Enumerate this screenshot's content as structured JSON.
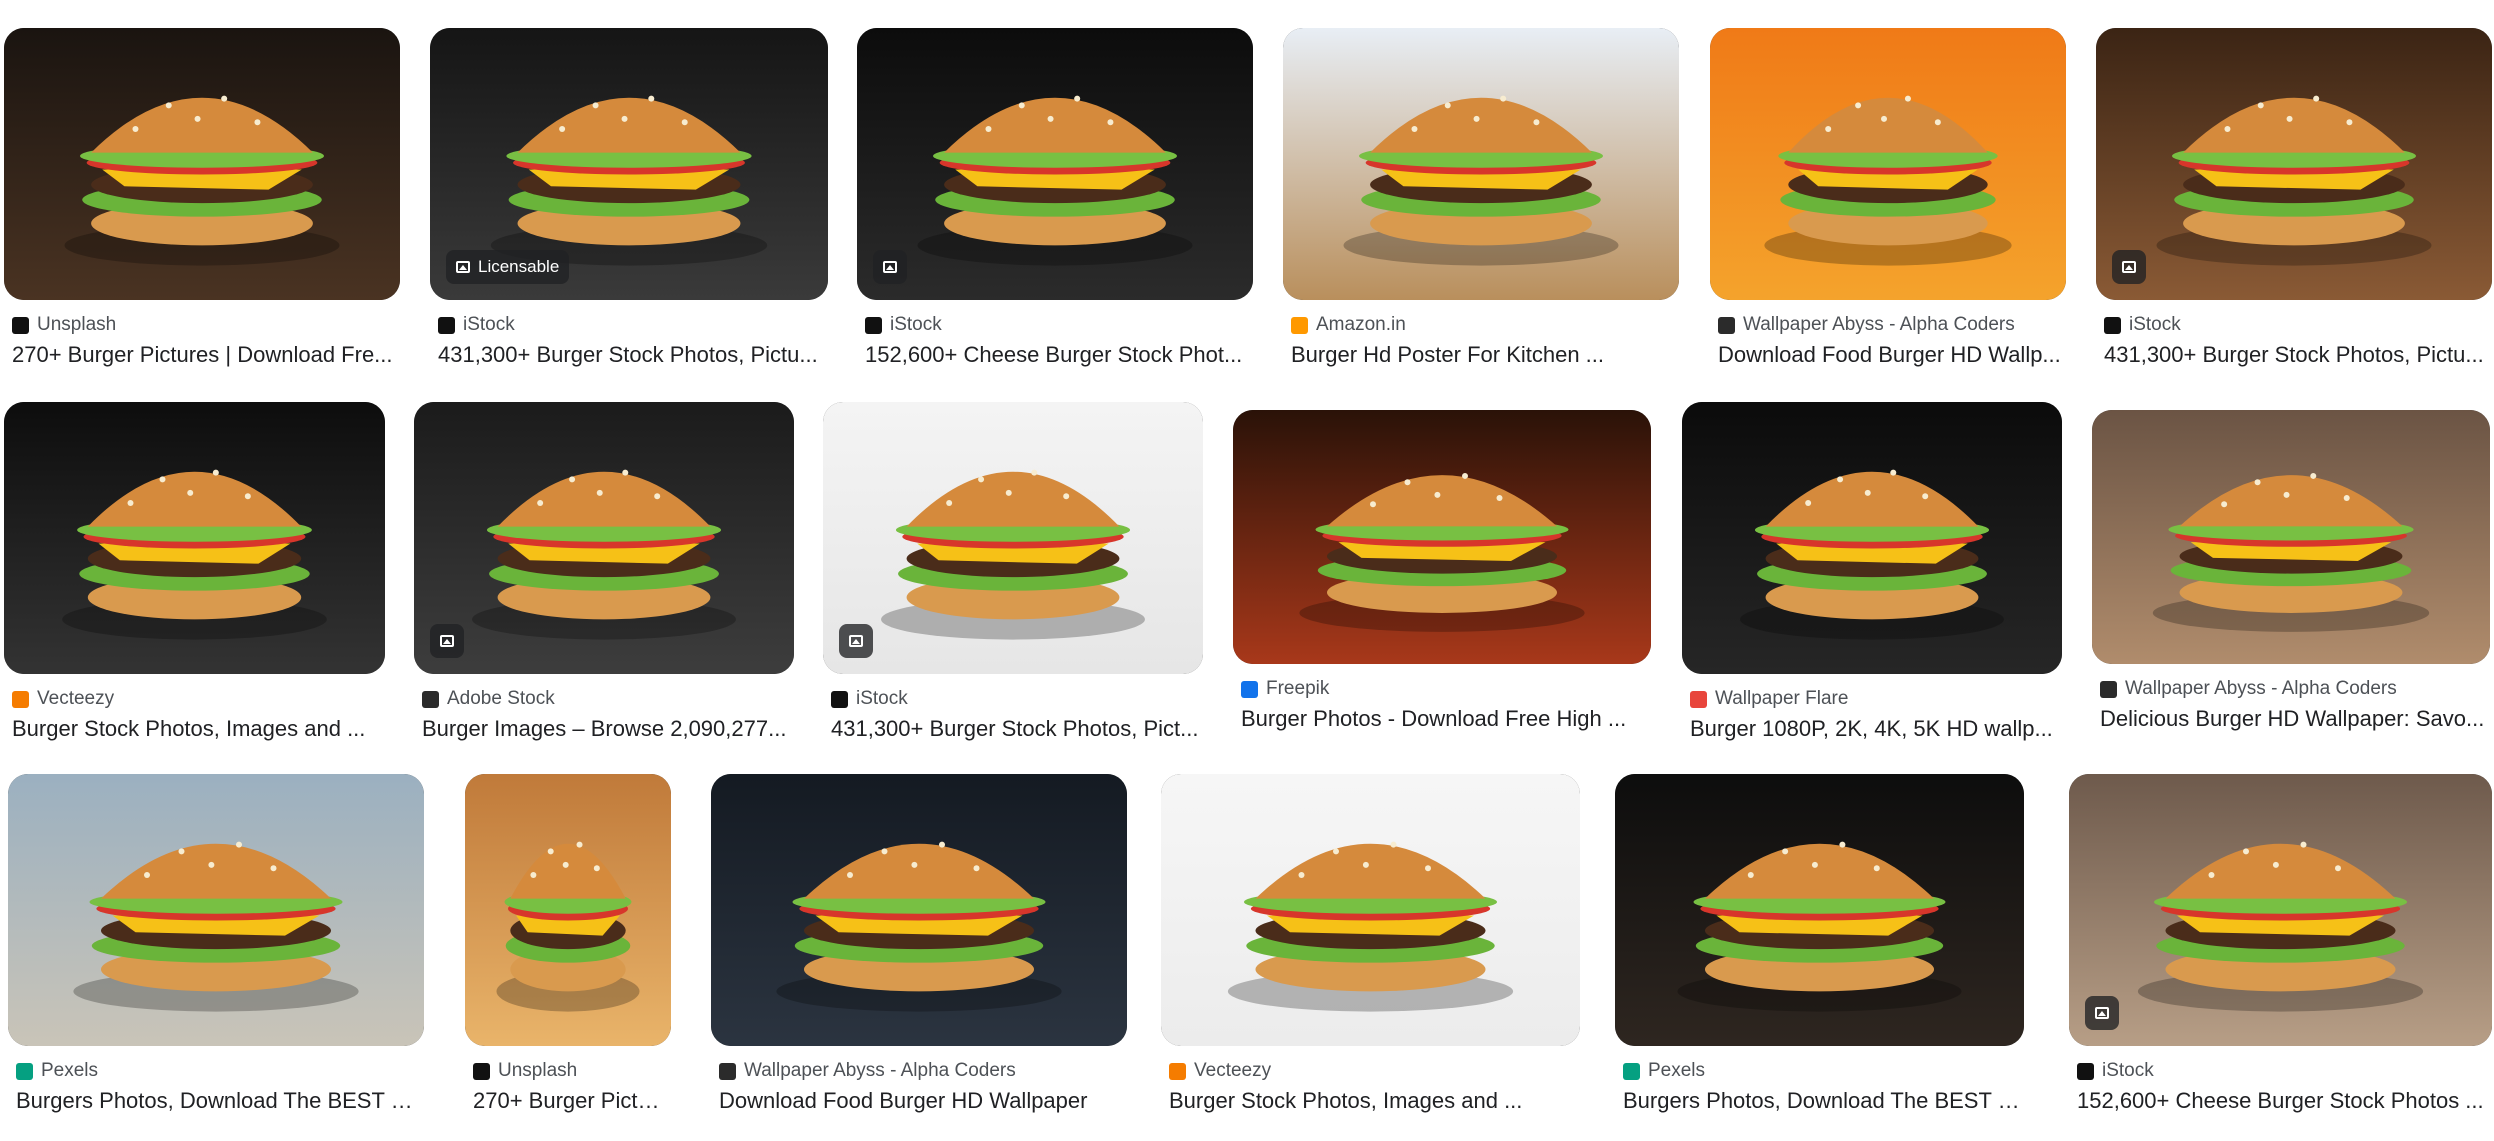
{
  "results": [
    {
      "source": "Unsplash",
      "title": "270+ Burger Pictures | Download Fre...",
      "badge": "",
      "favicon": "unsplash-icon",
      "fav_color": "#111111",
      "bg": [
        "#1a1410",
        "#4a3322"
      ]
    },
    {
      "source": "iStock",
      "title": "431,300+ Burger Stock Photos, Pictu...",
      "badge": "Licensable",
      "favicon": "istock-icon",
      "fav_color": "#111111",
      "bg": [
        "#151515",
        "#3a3a3a"
      ]
    },
    {
      "source": "iStock",
      "title": "152,600+ Cheese Burger Stock Phot...",
      "badge": "image",
      "favicon": "istock-icon",
      "fav_color": "#111111",
      "bg": [
        "#0c0c0c",
        "#2b2b2b"
      ]
    },
    {
      "source": "Amazon.in",
      "title": "Burger Hd Poster For Kitchen ...",
      "badge": "",
      "favicon": "amazon-icon",
      "fav_color": "#ff9900",
      "bg": [
        "#e8eef5",
        "#b98f5c"
      ]
    },
    {
      "source": "Wallpaper Abyss - Alpha Coders",
      "title": "Download Food Burger HD Wallp...",
      "badge": "",
      "favicon": "wallpaper-abyss-icon",
      "fav_color": "#2b2b2b",
      "bg": [
        "#f07a17",
        "#f4a32c"
      ]
    },
    {
      "source": "iStock",
      "title": "431,300+ Burger Stock Photos, Pictu...",
      "badge": "image",
      "favicon": "istock-icon",
      "fav_color": "#111111",
      "bg": [
        "#3b2414",
        "#8a5a35"
      ]
    },
    {
      "source": "Vecteezy",
      "title": "Burger Stock Photos, Images and ...",
      "badge": "",
      "favicon": "vecteezy-icon",
      "fav_color": "#f57c00",
      "bg": [
        "#0d0d0d",
        "#333333"
      ]
    },
    {
      "source": "Adobe Stock",
      "title": "Burger Images – Browse 2,090,277...",
      "badge": "image",
      "favicon": "adobe-stock-icon",
      "fav_color": "#2b2b2b",
      "bg": [
        "#1b1b1b",
        "#3d3d3d"
      ]
    },
    {
      "source": "iStock",
      "title": "431,300+ Burger Stock Photos, Pict...",
      "badge": "image",
      "favicon": "istock-icon",
      "fav_color": "#111111",
      "bg": [
        "#f4f4f4",
        "#e6e6e6"
      ]
    },
    {
      "source": "Freepik",
      "title": "Burger Photos - Download Free High ...",
      "badge": "",
      "favicon": "freepik-icon",
      "fav_color": "#1273eb",
      "bg": [
        "#2a1208",
        "#a8381a"
      ]
    },
    {
      "source": "Wallpaper Flare",
      "title": "Burger 1080P, 2K, 4K, 5K HD wallp...",
      "badge": "",
      "favicon": "flame-icon",
      "fav_color": "#e8453c",
      "bg": [
        "#0b0b0b",
        "#262626"
      ]
    },
    {
      "source": "Wallpaper Abyss - Alpha Coders",
      "title": "Delicious Burger HD Wallpaper: Savo...",
      "badge": "",
      "favicon": "wallpaper-abyss-icon",
      "fav_color": "#2b2b2b",
      "bg": [
        "#6b5444",
        "#b08c6c"
      ]
    },
    {
      "source": "Pexels",
      "title": "Burgers Photos, Download The BEST Fr...",
      "badge": "",
      "favicon": "pexels-icon",
      "fav_color": "#05a081",
      "bg": [
        "#9bb0c0",
        "#c9c4b8"
      ]
    },
    {
      "source": "Unsplash",
      "title": "270+ Burger Pictur...",
      "badge": "",
      "favicon": "unsplash-icon",
      "fav_color": "#111111",
      "bg": [
        "#c07a3a",
        "#e9b46a"
      ]
    },
    {
      "source": "Wallpaper Abyss - Alpha Coders",
      "title": "Download Food Burger HD Wallpaper",
      "badge": "",
      "favicon": "wallpaper-abyss-icon",
      "fav_color": "#2b2b2b",
      "bg": [
        "#141a22",
        "#2b3440"
      ]
    },
    {
      "source": "Vecteezy",
      "title": "Burger Stock Photos, Images and ...",
      "badge": "",
      "favicon": "vecteezy-icon",
      "fav_color": "#f57c00",
      "bg": [
        "#f6f6f6",
        "#ececec"
      ]
    },
    {
      "source": "Pexels",
      "title": "Burgers Photos, Download The BEST Fr...",
      "badge": "",
      "favicon": "pexels-icon",
      "fav_color": "#05a081",
      "bg": [
        "#0d0d0d",
        "#2e2620"
      ]
    },
    {
      "source": "iStock",
      "title": "152,600+ Cheese Burger Stock Photos ...",
      "badge": "image",
      "favicon": "istock-icon",
      "fav_color": "#111111",
      "bg": [
        "#6e5a4c",
        "#b79e86"
      ]
    }
  ]
}
